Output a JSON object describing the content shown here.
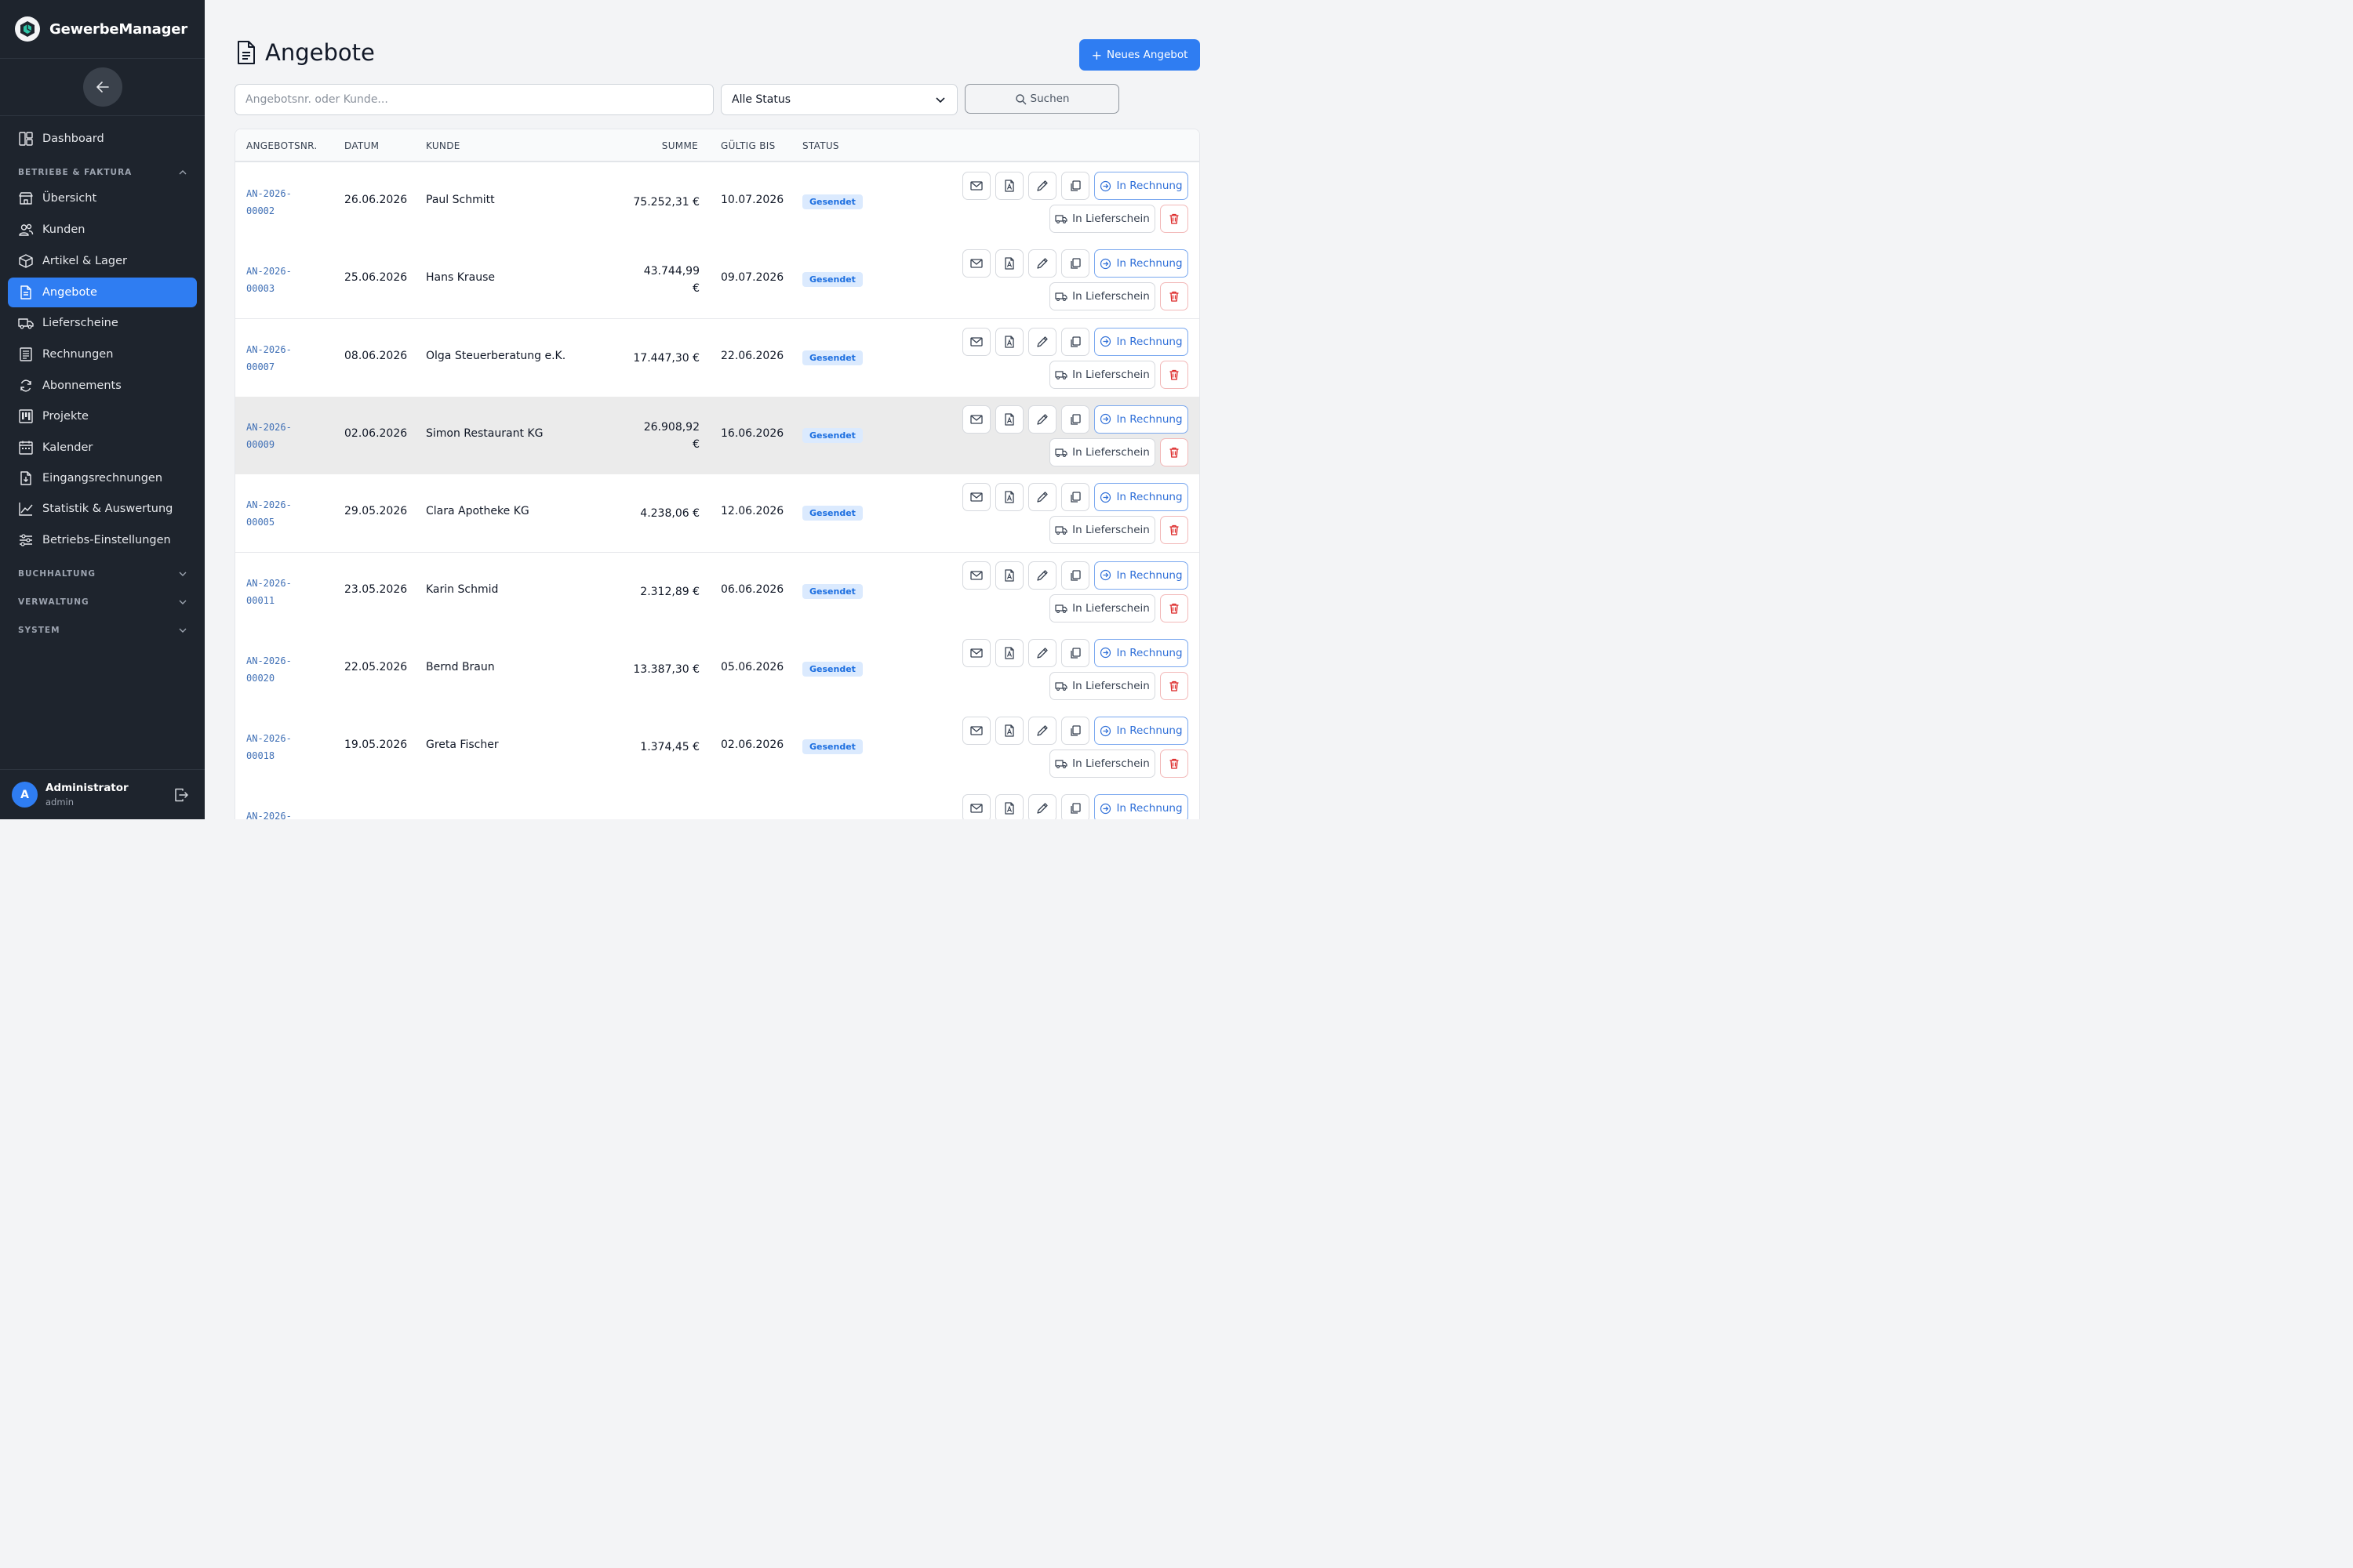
{
  "app": {
    "name": "GewerbeManager"
  },
  "sidebar": {
    "items_top": [
      {
        "label": "Dashboard",
        "icon": "dashboard-icon"
      }
    ],
    "section_betriebe": "BETRIEBE & FAKTURA",
    "items": [
      {
        "label": "Übersicht",
        "icon": "store-icon"
      },
      {
        "label": "Kunden",
        "icon": "users-icon"
      },
      {
        "label": "Artikel & Lager",
        "icon": "box-icon"
      },
      {
        "label": "Angebote",
        "icon": "document-icon",
        "active": true
      },
      {
        "label": "Lieferscheine",
        "icon": "truck-icon"
      },
      {
        "label": "Rechnungen",
        "icon": "receipt-icon"
      },
      {
        "label": "Abonnements",
        "icon": "refresh-icon"
      },
      {
        "label": "Projekte",
        "icon": "kanban-icon"
      },
      {
        "label": "Kalender",
        "icon": "calendar-icon"
      },
      {
        "label": "Eingangsrechnungen",
        "icon": "file-download-icon"
      },
      {
        "label": "Statistik & Auswertung",
        "icon": "chart-icon"
      },
      {
        "label": "Betriebs-Einstellungen",
        "icon": "sliders-icon"
      }
    ],
    "sections_collapsed": [
      "BUCHHALTUNG",
      "VERWALTUNG",
      "SYSTEM"
    ],
    "user": {
      "initial": "A",
      "name": "Administrator",
      "role": "admin"
    }
  },
  "main": {
    "title": "Angebote",
    "new_button": "Neues Angebot",
    "search_placeholder": "Angebotsnr. oder Kunde...",
    "status_select": "Alle Status",
    "search_button": "Suchen",
    "columns": [
      "ANGEBOTSNR.",
      "DATUM",
      "KUNDE",
      "SUMME",
      "GÜLTIG BIS",
      "STATUS"
    ],
    "action_labels": {
      "invoice": "In Rechnung",
      "delivery": "In Lieferschein"
    },
    "rows": [
      {
        "nr1": "AN-2026-",
        "nr2": "00002",
        "datum": "26.06.2026",
        "kunde": "Paul Schmitt",
        "summe1": "75.252,31 €",
        "summe2": "",
        "gueltig": "10.07.2026",
        "status": "Gesendet"
      },
      {
        "nr1": "AN-2026-",
        "nr2": "00003",
        "datum": "25.06.2026",
        "kunde": "Hans Krause",
        "summe1": "43.744,99",
        "summe2": "€",
        "gueltig": "09.07.2026",
        "status": "Gesendet"
      },
      {
        "nr1": "AN-2026-",
        "nr2": "00007",
        "datum": "08.06.2026",
        "kunde": "Olga Steuerberatung e.K.",
        "summe1": "17.447,30 €",
        "summe2": "",
        "gueltig": "22.06.2026",
        "status": "Gesendet"
      },
      {
        "nr1": "AN-2026-",
        "nr2": "00009",
        "datum": "02.06.2026",
        "kunde": "Simon Restaurant KG",
        "summe1": "26.908,92",
        "summe2": "€",
        "gueltig": "16.06.2026",
        "status": "Gesendet",
        "highlight": true
      },
      {
        "nr1": "AN-2026-",
        "nr2": "00005",
        "datum": "29.05.2026",
        "kunde": "Clara Apotheke KG",
        "summe1": "4.238,06 €",
        "summe2": "",
        "gueltig": "12.06.2026",
        "status": "Gesendet"
      },
      {
        "nr1": "AN-2026-",
        "nr2": "00011",
        "datum": "23.05.2026",
        "kunde": "Karin Schmid",
        "summe1": "2.312,89 €",
        "summe2": "",
        "gueltig": "06.06.2026",
        "status": "Gesendet"
      },
      {
        "nr1": "AN-2026-",
        "nr2": "00020",
        "datum": "22.05.2026",
        "kunde": "Bernd Braun",
        "summe1": "13.387,30 €",
        "summe2": "",
        "gueltig": "05.06.2026",
        "status": "Gesendet"
      },
      {
        "nr1": "AN-2026-",
        "nr2": "00018",
        "datum": "19.05.2026",
        "kunde": "Greta Fischer",
        "summe1": "1.374,45 €",
        "summe2": "",
        "gueltig": "02.06.2026",
        "status": "Gesendet"
      },
      {
        "nr1": "AN-2026-",
        "nr2": "",
        "datum": "",
        "kunde": "",
        "summe1": "",
        "summe2": "",
        "gueltig": "",
        "status": ""
      }
    ]
  }
}
